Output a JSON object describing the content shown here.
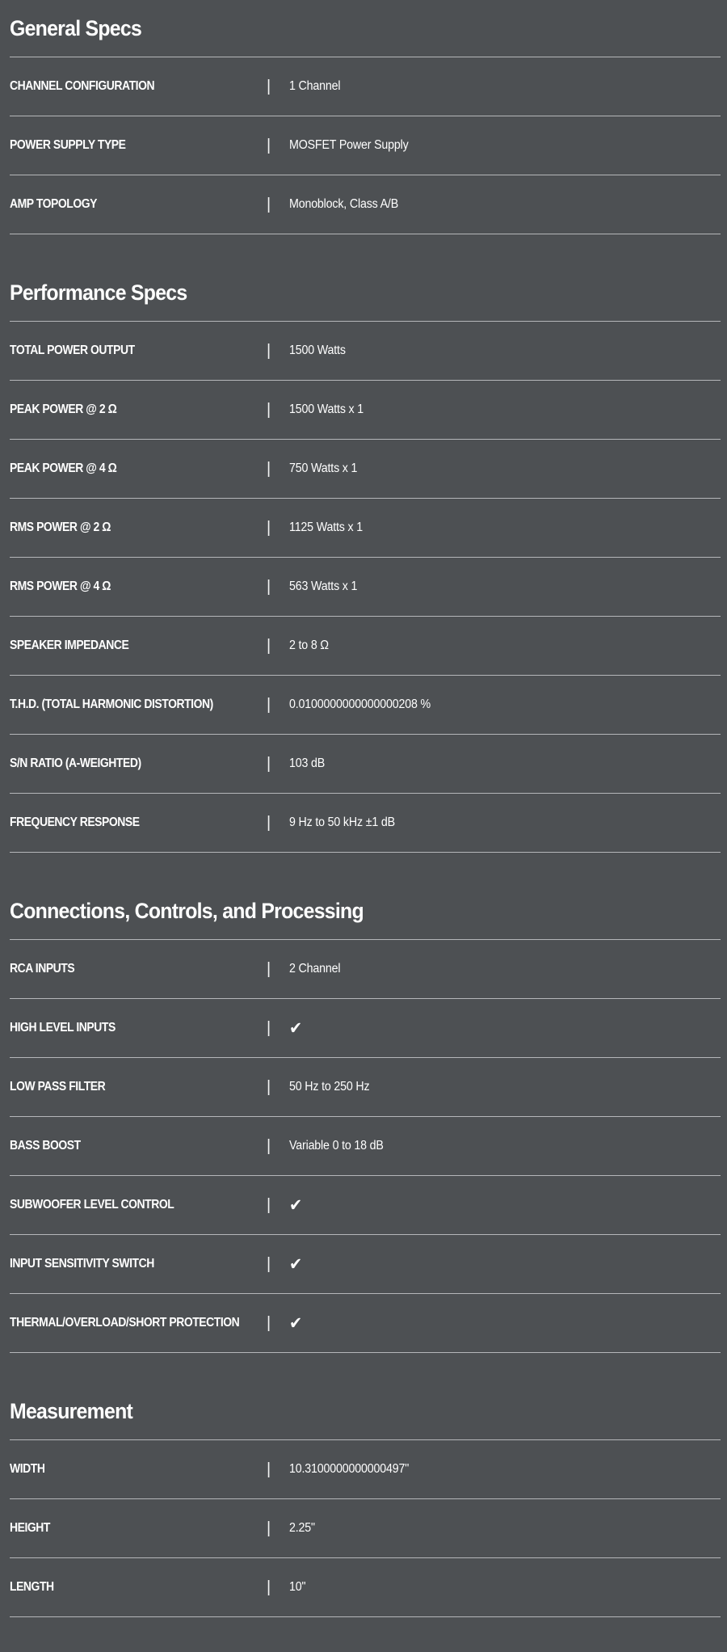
{
  "sections": [
    {
      "title": "General Specs",
      "rows": [
        {
          "label": "CHANNEL CONFIGURATION",
          "value": "1 Channel"
        },
        {
          "label": "POWER SUPPLY TYPE",
          "value": "MOSFET Power Supply"
        },
        {
          "label": "AMP TOPOLOGY",
          "value": "Monoblock, Class A/B"
        }
      ]
    },
    {
      "title": "Performance Specs",
      "rows": [
        {
          "label": "TOTAL POWER OUTPUT",
          "value": "1500 Watts"
        },
        {
          "label": "PEAK POWER @ 2 Ω",
          "value": "1500 Watts x 1"
        },
        {
          "label": "PEAK POWER @ 4 Ω",
          "value": "750 Watts x 1"
        },
        {
          "label": "RMS POWER @ 2 Ω",
          "value": "1125 Watts x 1"
        },
        {
          "label": "RMS POWER @ 4 Ω",
          "value": "563 Watts x 1"
        },
        {
          "label": "SPEAKER IMPEDANCE",
          "value": "2 to 8 Ω"
        },
        {
          "label": "T.H.D. (TOTAL HARMONIC DISTORTION)",
          "value": "0.0100000000000000208 %"
        },
        {
          "label": "S/N RATIO (A-WEIGHTED)",
          "value": "103 dB"
        },
        {
          "label": "FREQUENCY RESPONSE",
          "value": "9 Hz to 50 kHz ±1 dB"
        }
      ]
    },
    {
      "title": "Connections, Controls, and Processing",
      "rows": [
        {
          "label": "RCA INPUTS",
          "value": "2 Channel"
        },
        {
          "label": "HIGH LEVEL INPUTS",
          "value": "✔"
        },
        {
          "label": "LOW PASS FILTER",
          "value": "50 Hz to 250 Hz"
        },
        {
          "label": "BASS BOOST",
          "value": "Variable 0 to 18 dB"
        },
        {
          "label": "SUBWOOFER LEVEL CONTROL",
          "value": "✔"
        },
        {
          "label": "INPUT SENSITIVITY SWITCH",
          "value": "✔"
        },
        {
          "label": "THERMAL/OVERLOAD/SHORT PROTECTION",
          "value": "✔"
        }
      ]
    },
    {
      "title": "Measurement",
      "rows": [
        {
          "label": "WIDTH",
          "value": "10.3100000000000497\""
        },
        {
          "label": "HEIGHT",
          "value": "2.25\""
        },
        {
          "label": "LENGTH",
          "value": "10\""
        }
      ]
    }
  ],
  "separator": "|",
  "colors": {
    "background": "#4d5053",
    "text": "#ffffff",
    "divider": "#b5b7b9"
  }
}
